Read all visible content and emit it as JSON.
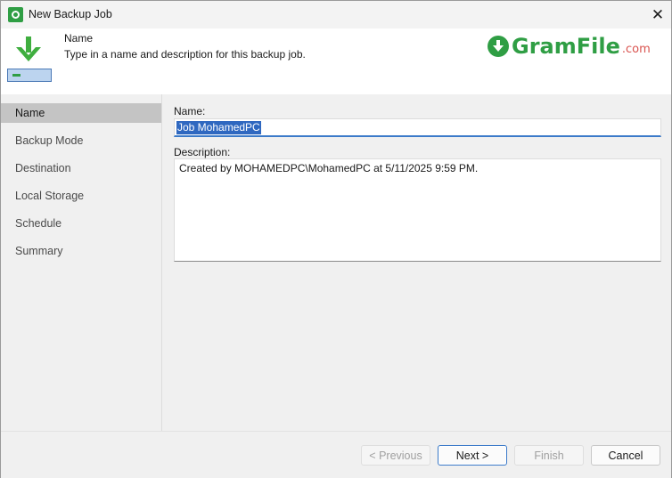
{
  "window": {
    "title": "New Backup Job",
    "close_glyph": "✕",
    "icon": "veeam-gear-icon"
  },
  "header": {
    "title": "Name",
    "subtitle": "Type in a name and description for this backup job.",
    "icon": "download-arrow-icon",
    "brand_word": "GramFile",
    "brand_tld": ".com"
  },
  "nav": {
    "items": [
      {
        "label": "Name",
        "active": true
      },
      {
        "label": "Backup Mode",
        "active": false
      },
      {
        "label": "Destination",
        "active": false
      },
      {
        "label": "Local Storage",
        "active": false
      },
      {
        "label": "Schedule",
        "active": false
      },
      {
        "label": "Summary",
        "active": false
      }
    ]
  },
  "form": {
    "name_label": "Name:",
    "name_value": "Job MohamedPC",
    "description_label": "Description:",
    "description_value": "Created by MOHAMEDPC\\MohamedPC at 5/11/2025 9:59 PM."
  },
  "buttons": {
    "previous": "< Previous",
    "next": "Next >",
    "finish": "Finish",
    "cancel": "Cancel"
  },
  "colors": {
    "accent": "#2f9e44",
    "selection": "#2f68c0",
    "focus_border": "#3b7ac9",
    "active_nav": "#c4c4c4"
  }
}
